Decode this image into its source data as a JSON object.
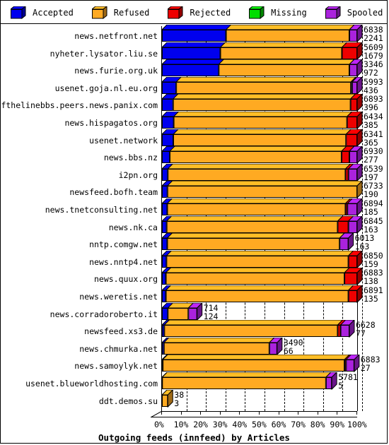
{
  "legend": {
    "items": [
      {
        "label": "Accepted",
        "color": "#0000ee",
        "icon": "cube-icon"
      },
      {
        "label": "Refused",
        "color": "#ffaa22",
        "icon": "cube-icon"
      },
      {
        "label": "Rejected",
        "color": "#ee0000",
        "icon": "cube-icon"
      },
      {
        "label": "Missing",
        "color": "#00dd00",
        "icon": "cube-icon"
      },
      {
        "label": "Spooled",
        "color": "#aa22dd",
        "icon": "cube-icon"
      }
    ]
  },
  "chart_data": {
    "type": "bar",
    "orientation": "horizontal",
    "stacked": true,
    "percent_axis": true,
    "title": "Outgoing feeds (innfeed) by Articles",
    "xlabel": "Outgoing feeds (innfeed) by Articles",
    "ylabel": "",
    "xlim": [
      0,
      100
    ],
    "grid": true,
    "legend_position": "top",
    "tick_labels": [
      "0%",
      "10%",
      "20%",
      "30%",
      "40%",
      "50%",
      "60%",
      "70%",
      "80%",
      "90%",
      "100%"
    ],
    "tick_values": [
      0,
      10,
      20,
      30,
      40,
      50,
      60,
      70,
      80,
      90,
      100
    ],
    "series": [
      {
        "name": "Accepted",
        "color": "#0000ee"
      },
      {
        "name": "Refused",
        "color": "#ffaa22"
      },
      {
        "name": "Rejected",
        "color": "#ee0000"
      },
      {
        "name": "Missing",
        "color": "#00dd00"
      },
      {
        "name": "Spooled",
        "color": "#aa22dd"
      }
    ],
    "categories": [
      "news.netfront.net",
      "nyheter.lysator.liu.se",
      "news.furie.org.uk",
      "usenet.goja.nl.eu.org",
      "endofthelinebbs.peers.news.panix.com",
      "news.hispagatos.org",
      "usenet.network",
      "news.bbs.nz",
      "i2pn.org",
      "newsfeed.bofh.team",
      "news.tnetconsulting.net",
      "news.nk.ca",
      "nntp.comgw.net",
      "news.nntp4.net",
      "news.quux.org",
      "news.weretis.net",
      "news.corradoroberto.it",
      "newsfeed.xs3.de",
      "news.chmurka.net",
      "news.samoylyk.net",
      "usenet.blueworldhosting.com",
      "ddt.demos.su"
    ],
    "rows": [
      {
        "label": "news.netfront.net",
        "total": 6838,
        "sub": 2241,
        "segments": [
          {
            "name": "Accepted",
            "pct": 32.8
          },
          {
            "name": "Refused",
            "pct": 63.2
          },
          {
            "name": "Rejected",
            "pct": 0.0
          },
          {
            "name": "Missing",
            "pct": 0.0
          },
          {
            "name": "Spooled",
            "pct": 4.0
          }
        ]
      },
      {
        "label": "nyheter.lysator.liu.se",
        "total": 5609,
        "sub": 1679,
        "segments": [
          {
            "name": "Accepted",
            "pct": 29.9
          },
          {
            "name": "Refused",
            "pct": 62.3
          },
          {
            "name": "Rejected",
            "pct": 7.8
          },
          {
            "name": "Missing",
            "pct": 0.0
          },
          {
            "name": "Spooled",
            "pct": 0.0
          }
        ]
      },
      {
        "label": "news.furie.org.uk",
        "total": 3346,
        "sub": 972,
        "segments": [
          {
            "name": "Accepted",
            "pct": 29.1
          },
          {
            "name": "Refused",
            "pct": 66.9
          },
          {
            "name": "Rejected",
            "pct": 0.0
          },
          {
            "name": "Missing",
            "pct": 0.0
          },
          {
            "name": "Spooled",
            "pct": 4.0
          }
        ]
      },
      {
        "label": "usenet.goja.nl.eu.org",
        "total": 5993,
        "sub": 436,
        "segments": [
          {
            "name": "Accepted",
            "pct": 7.3
          },
          {
            "name": "Refused",
            "pct": 89.5
          },
          {
            "name": "Rejected",
            "pct": 0.6
          },
          {
            "name": "Missing",
            "pct": 0.0
          },
          {
            "name": "Spooled",
            "pct": 2.6
          }
        ]
      },
      {
        "label": "endofthelinebbs.peers.news.panix.com",
        "total": 6893,
        "sub": 396,
        "segments": [
          {
            "name": "Accepted",
            "pct": 5.7
          },
          {
            "name": "Refused",
            "pct": 90.9
          },
          {
            "name": "Rejected",
            "pct": 3.4
          },
          {
            "name": "Missing",
            "pct": 0.0
          },
          {
            "name": "Spooled",
            "pct": 0.0
          }
        ]
      },
      {
        "label": "news.hispagatos.org",
        "total": 6434,
        "sub": 385,
        "segments": [
          {
            "name": "Accepted",
            "pct": 6.0
          },
          {
            "name": "Refused",
            "pct": 88.8
          },
          {
            "name": "Rejected",
            "pct": 5.2
          },
          {
            "name": "Missing",
            "pct": 0.0
          },
          {
            "name": "Spooled",
            "pct": 0.0
          }
        ]
      },
      {
        "label": "usenet.network",
        "total": 6341,
        "sub": 365,
        "segments": [
          {
            "name": "Accepted",
            "pct": 5.8
          },
          {
            "name": "Refused",
            "pct": 88.5
          },
          {
            "name": "Rejected",
            "pct": 5.7
          },
          {
            "name": "Missing",
            "pct": 0.0
          },
          {
            "name": "Spooled",
            "pct": 0.0
          }
        ]
      },
      {
        "label": "news.bbs.nz",
        "total": 6930,
        "sub": 277,
        "segments": [
          {
            "name": "Accepted",
            "pct": 4.0
          },
          {
            "name": "Refused",
            "pct": 88.0
          },
          {
            "name": "Rejected",
            "pct": 4.0
          },
          {
            "name": "Missing",
            "pct": 0.0
          },
          {
            "name": "Spooled",
            "pct": 4.0
          }
        ]
      },
      {
        "label": "i2pn.org",
        "total": 6539,
        "sub": 197,
        "segments": [
          {
            "name": "Accepted",
            "pct": 3.0
          },
          {
            "name": "Refused",
            "pct": 91.0
          },
          {
            "name": "Rejected",
            "pct": 1.5
          },
          {
            "name": "Missing",
            "pct": 0.0
          },
          {
            "name": "Spooled",
            "pct": 4.5
          }
        ]
      },
      {
        "label": "newsfeed.bofh.team",
        "total": 6733,
        "sub": 190,
        "segments": [
          {
            "name": "Accepted",
            "pct": 2.8
          },
          {
            "name": "Refused",
            "pct": 97.2
          },
          {
            "name": "Rejected",
            "pct": 0.0
          },
          {
            "name": "Missing",
            "pct": 0.0
          },
          {
            "name": "Spooled",
            "pct": 0.0
          }
        ]
      },
      {
        "label": "news.tnetconsulting.net",
        "total": 6894,
        "sub": 185,
        "segments": [
          {
            "name": "Accepted",
            "pct": 2.7
          },
          {
            "name": "Refused",
            "pct": 91.3
          },
          {
            "name": "Rejected",
            "pct": 1.0
          },
          {
            "name": "Missing",
            "pct": 0.0
          },
          {
            "name": "Spooled",
            "pct": 5.0
          }
        ]
      },
      {
        "label": "news.nk.ca",
        "total": 6845,
        "sub": 163,
        "segments": [
          {
            "name": "Accepted",
            "pct": 2.4
          },
          {
            "name": "Refused",
            "pct": 87.6
          },
          {
            "name": "Rejected",
            "pct": 5.5
          },
          {
            "name": "Missing",
            "pct": 0.0
          },
          {
            "name": "Spooled",
            "pct": 4.5
          }
        ]
      },
      {
        "label": "nntp.comgw.net",
        "total": 6013,
        "sub": 163,
        "segments": [
          {
            "name": "Accepted",
            "pct": 2.7
          },
          {
            "name": "Refused",
            "pct": 88.3
          },
          {
            "name": "Rejected",
            "pct": 0.0
          },
          {
            "name": "Missing",
            "pct": 0.0
          },
          {
            "name": "Spooled",
            "pct": 4.5
          }
        ]
      },
      {
        "label": "news.nntp4.net",
        "total": 6850,
        "sub": 159,
        "segments": [
          {
            "name": "Accepted",
            "pct": 2.3
          },
          {
            "name": "Refused",
            "pct": 93.2
          },
          {
            "name": "Rejected",
            "pct": 4.5
          },
          {
            "name": "Missing",
            "pct": 0.0
          },
          {
            "name": "Spooled",
            "pct": 0.0
          }
        ]
      },
      {
        "label": "news.quux.org",
        "total": 6883,
        "sub": 138,
        "segments": [
          {
            "name": "Accepted",
            "pct": 2.0
          },
          {
            "name": "Refused",
            "pct": 91.5
          },
          {
            "name": "Rejected",
            "pct": 6.5
          },
          {
            "name": "Missing",
            "pct": 0.0
          },
          {
            "name": "Spooled",
            "pct": 0.0
          }
        ]
      },
      {
        "label": "news.weretis.net",
        "total": 6891,
        "sub": 135,
        "segments": [
          {
            "name": "Accepted",
            "pct": 2.0
          },
          {
            "name": "Refused",
            "pct": 93.5
          },
          {
            "name": "Rejected",
            "pct": 4.5
          },
          {
            "name": "Missing",
            "pct": 0.0
          },
          {
            "name": "Spooled",
            "pct": 0.0
          }
        ]
      },
      {
        "label": "news.corradoroberto.it",
        "total": 714,
        "sub": 124,
        "segments": [
          {
            "name": "Accepted",
            "pct": 3.0
          },
          {
            "name": "Refused",
            "pct": 10.5
          },
          {
            "name": "Rejected",
            "pct": 0.0
          },
          {
            "name": "Missing",
            "pct": 0.0
          },
          {
            "name": "Spooled",
            "pct": 4.5
          }
        ]
      },
      {
        "label": "newsfeed.xs3.de",
        "total": 6628,
        "sub": 77,
        "segments": [
          {
            "name": "Accepted",
            "pct": 1.2
          },
          {
            "name": "Refused",
            "pct": 88.8
          },
          {
            "name": "Rejected",
            "pct": 1.5
          },
          {
            "name": "Missing",
            "pct": 0.0
          },
          {
            "name": "Spooled",
            "pct": 4.5
          }
        ]
      },
      {
        "label": "news.chmurka.net",
        "total": 3490,
        "sub": 66,
        "segments": [
          {
            "name": "Accepted",
            "pct": 1.0
          },
          {
            "name": "Refused",
            "pct": 54.0
          },
          {
            "name": "Rejected",
            "pct": 0.0
          },
          {
            "name": "Missing",
            "pct": 0.0
          },
          {
            "name": "Spooled",
            "pct": 4.0
          }
        ]
      },
      {
        "label": "news.samoylyk.net",
        "total": 6883,
        "sub": 27,
        "segments": [
          {
            "name": "Accepted",
            "pct": 0.4
          },
          {
            "name": "Refused",
            "pct": 93.1
          },
          {
            "name": "Rejected",
            "pct": 0.8
          },
          {
            "name": "Missing",
            "pct": 0.0
          },
          {
            "name": "Spooled",
            "pct": 4.2
          }
        ]
      },
      {
        "label": "usenet.blueworldhosting.com",
        "total": 5781,
        "sub": 5,
        "segments": [
          {
            "name": "Accepted",
            "pct": 0.1
          },
          {
            "name": "Refused",
            "pct": 83.9
          },
          {
            "name": "Rejected",
            "pct": 0.0
          },
          {
            "name": "Missing",
            "pct": 0.0
          },
          {
            "name": "Spooled",
            "pct": 3.0
          }
        ]
      },
      {
        "label": "ddt.demos.su",
        "total": 38,
        "sub": 3,
        "segments": [
          {
            "name": "Accepted",
            "pct": 0.0
          },
          {
            "name": "Refused",
            "pct": 3.0
          },
          {
            "name": "Rejected",
            "pct": 0.0
          },
          {
            "name": "Missing",
            "pct": 0.0
          },
          {
            "name": "Spooled",
            "pct": 0.0
          }
        ]
      }
    ]
  }
}
